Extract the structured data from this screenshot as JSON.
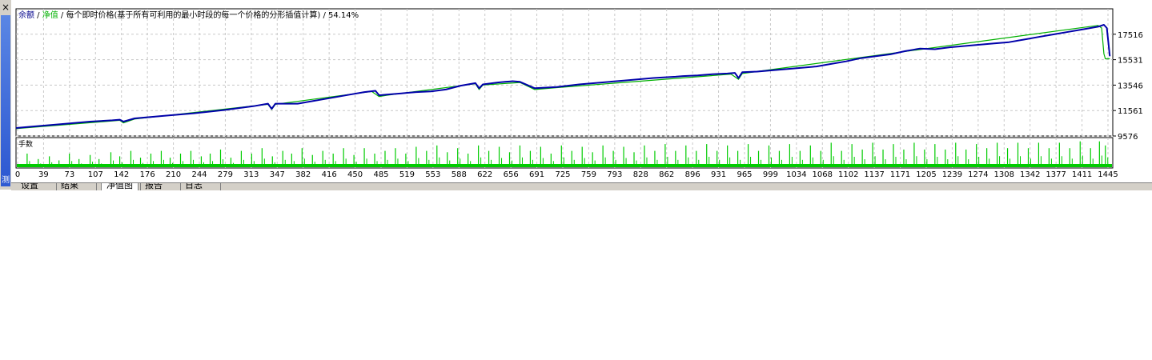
{
  "window": {
    "close_label": "×",
    "side_label": "测"
  },
  "chart_data": {
    "type": "line",
    "title_parts": [
      {
        "text": "余额",
        "color": "#00008b"
      },
      {
        "text": " / ",
        "color": "#000000"
      },
      {
        "text": "净值",
        "color": "#00b000"
      },
      {
        "text": " / 每个即时价格(基于所有可利用的最小时段的每一个价格的分形插值计算) / 54.14%",
        "color": "#000000"
      }
    ],
    "ylim": [
      9576,
      19500
    ],
    "y_ticks": [
      "17516",
      "15531",
      "13546",
      "11561",
      "9576"
    ],
    "x_ticks": [
      "0",
      "39",
      "73",
      "107",
      "142",
      "176",
      "210",
      "244",
      "279",
      "313",
      "347",
      "382",
      "416",
      "450",
      "485",
      "519",
      "553",
      "588",
      "622",
      "656",
      "691",
      "725",
      "759",
      "793",
      "828",
      "862",
      "896",
      "931",
      "965",
      "999",
      "1034",
      "1068",
      "1102",
      "1137",
      "1171",
      "1205",
      "1239",
      "1274",
      "1308",
      "1342",
      "1377",
      "1411",
      "1445"
    ],
    "xlim": [
      0,
      1480
    ],
    "series": [
      {
        "name": "余额",
        "color": "#0000aa",
        "x": [
          0,
          20,
          60,
          100,
          130,
          140,
          145,
          160,
          200,
          240,
          280,
          320,
          340,
          345,
          350,
          380,
          400,
          420,
          450,
          470,
          485,
          490,
          500,
          520,
          540,
          560,
          580,
          600,
          620,
          625,
          630,
          650,
          660,
          670,
          680,
          700,
          730,
          760,
          790,
          820,
          860,
          890,
          900,
          920,
          940,
          960,
          970,
          975,
          980,
          1000,
          1030,
          1060,
          1080,
          1100,
          1120,
          1140,
          1160,
          1180,
          1200,
          1210,
          1220,
          1240,
          1260,
          1280,
          1300,
          1320,
          1340,
          1360,
          1380,
          1400,
          1420,
          1440,
          1460,
          1468,
          1472,
          1476
        ],
        "values": [
          10200,
          10300,
          10500,
          10700,
          10800,
          10850,
          10700,
          10950,
          11150,
          11350,
          11600,
          11900,
          12100,
          11700,
          12100,
          12100,
          12300,
          12500,
          12800,
          13000,
          13100,
          12750,
          12800,
          12900,
          13000,
          13050,
          13200,
          13500,
          13700,
          13300,
          13600,
          13750,
          13800,
          13850,
          13800,
          13300,
          13400,
          13600,
          13750,
          13900,
          14100,
          14200,
          14250,
          14300,
          14400,
          14450,
          14500,
          14100,
          14550,
          14600,
          14750,
          14900,
          15000,
          15200,
          15400,
          15650,
          15800,
          15950,
          16200,
          16300,
          16400,
          16350,
          16500,
          16600,
          16700,
          16800,
          16900,
          17100,
          17300,
          17500,
          17700,
          17900,
          18100,
          18250,
          18000,
          15800
        ]
      },
      {
        "name": "净值",
        "color": "#00b000",
        "x": [
          0,
          140,
          145,
          160,
          340,
          345,
          350,
          480,
          490,
          500,
          620,
          625,
          630,
          680,
          700,
          730,
          965,
          975,
          980,
          1460,
          1465,
          1468,
          1470,
          1476
        ],
        "values": [
          10150,
          10800,
          10600,
          10900,
          12050,
          11650,
          12050,
          13050,
          12650,
          12750,
          13650,
          13200,
          13550,
          13750,
          13200,
          13350,
          14400,
          14000,
          14450,
          18200,
          18000,
          16000,
          15600,
          15600
        ]
      }
    ],
    "sub_chart": {
      "label": "手数",
      "color": "#00cc00",
      "spikes": [
        {
          "x": 15,
          "h": 0.5
        },
        {
          "x": 30,
          "h": 0.3
        },
        {
          "x": 45,
          "h": 0.4
        },
        {
          "x": 58,
          "h": 0.25
        },
        {
          "x": 72,
          "h": 0.5
        },
        {
          "x": 85,
          "h": 0.3
        },
        {
          "x": 100,
          "h": 0.45
        },
        {
          "x": 112,
          "h": 0.3
        },
        {
          "x": 128,
          "h": 0.55
        },
        {
          "x": 140,
          "h": 0.4
        },
        {
          "x": 155,
          "h": 0.6
        },
        {
          "x": 168,
          "h": 0.35
        },
        {
          "x": 182,
          "h": 0.5
        },
        {
          "x": 196,
          "h": 0.6
        },
        {
          "x": 208,
          "h": 0.35
        },
        {
          "x": 222,
          "h": 0.5
        },
        {
          "x": 236,
          "h": 0.6
        },
        {
          "x": 250,
          "h": 0.4
        },
        {
          "x": 262,
          "h": 0.5
        },
        {
          "x": 276,
          "h": 0.65
        },
        {
          "x": 290,
          "h": 0.35
        },
        {
          "x": 304,
          "h": 0.6
        },
        {
          "x": 318,
          "h": 0.5
        },
        {
          "x": 332,
          "h": 0.7
        },
        {
          "x": 346,
          "h": 0.4
        },
        {
          "x": 360,
          "h": 0.6
        },
        {
          "x": 372,
          "h": 0.5
        },
        {
          "x": 386,
          "h": 0.7
        },
        {
          "x": 400,
          "h": 0.45
        },
        {
          "x": 414,
          "h": 0.6
        },
        {
          "x": 428,
          "h": 0.5
        },
        {
          "x": 442,
          "h": 0.7
        },
        {
          "x": 456,
          "h": 0.45
        },
        {
          "x": 470,
          "h": 0.7
        },
        {
          "x": 484,
          "h": 0.5
        },
        {
          "x": 498,
          "h": 0.6
        },
        {
          "x": 512,
          "h": 0.7
        },
        {
          "x": 526,
          "h": 0.5
        },
        {
          "x": 540,
          "h": 0.75
        },
        {
          "x": 554,
          "h": 0.6
        },
        {
          "x": 568,
          "h": 0.8
        },
        {
          "x": 582,
          "h": 0.55
        },
        {
          "x": 596,
          "h": 0.7
        },
        {
          "x": 610,
          "h": 0.5
        },
        {
          "x": 624,
          "h": 0.8
        },
        {
          "x": 638,
          "h": 0.6
        },
        {
          "x": 652,
          "h": 0.75
        },
        {
          "x": 666,
          "h": 0.55
        },
        {
          "x": 680,
          "h": 0.8
        },
        {
          "x": 694,
          "h": 0.6
        },
        {
          "x": 708,
          "h": 0.75
        },
        {
          "x": 722,
          "h": 0.5
        },
        {
          "x": 736,
          "h": 0.8
        },
        {
          "x": 750,
          "h": 0.6
        },
        {
          "x": 764,
          "h": 0.75
        },
        {
          "x": 778,
          "h": 0.55
        },
        {
          "x": 792,
          "h": 0.8
        },
        {
          "x": 806,
          "h": 0.6
        },
        {
          "x": 820,
          "h": 0.75
        },
        {
          "x": 834,
          "h": 0.55
        },
        {
          "x": 848,
          "h": 0.8
        },
        {
          "x": 862,
          "h": 0.6
        },
        {
          "x": 876,
          "h": 0.85
        },
        {
          "x": 890,
          "h": 0.6
        },
        {
          "x": 904,
          "h": 0.8
        },
        {
          "x": 918,
          "h": 0.6
        },
        {
          "x": 932,
          "h": 0.85
        },
        {
          "x": 946,
          "h": 0.6
        },
        {
          "x": 960,
          "h": 0.8
        },
        {
          "x": 974,
          "h": 0.6
        },
        {
          "x": 988,
          "h": 0.85
        },
        {
          "x": 1002,
          "h": 0.6
        },
        {
          "x": 1016,
          "h": 0.8
        },
        {
          "x": 1030,
          "h": 0.6
        },
        {
          "x": 1044,
          "h": 0.85
        },
        {
          "x": 1058,
          "h": 0.6
        },
        {
          "x": 1072,
          "h": 0.8
        },
        {
          "x": 1086,
          "h": 0.6
        },
        {
          "x": 1100,
          "h": 0.9
        },
        {
          "x": 1114,
          "h": 0.6
        },
        {
          "x": 1128,
          "h": 0.85
        },
        {
          "x": 1142,
          "h": 0.65
        },
        {
          "x": 1156,
          "h": 0.9
        },
        {
          "x": 1170,
          "h": 0.65
        },
        {
          "x": 1184,
          "h": 0.85
        },
        {
          "x": 1198,
          "h": 0.65
        },
        {
          "x": 1212,
          "h": 0.9
        },
        {
          "x": 1226,
          "h": 0.65
        },
        {
          "x": 1240,
          "h": 0.85
        },
        {
          "x": 1254,
          "h": 0.65
        },
        {
          "x": 1268,
          "h": 0.9
        },
        {
          "x": 1282,
          "h": 0.65
        },
        {
          "x": 1296,
          "h": 0.85
        },
        {
          "x": 1310,
          "h": 0.7
        },
        {
          "x": 1324,
          "h": 0.9
        },
        {
          "x": 1338,
          "h": 0.7
        },
        {
          "x": 1352,
          "h": 0.9
        },
        {
          "x": 1366,
          "h": 0.7
        },
        {
          "x": 1380,
          "h": 0.9
        },
        {
          "x": 1394,
          "h": 0.7
        },
        {
          "x": 1408,
          "h": 0.9
        },
        {
          "x": 1422,
          "h": 0.7
        },
        {
          "x": 1436,
          "h": 0.95
        },
        {
          "x": 1450,
          "h": 0.7
        },
        {
          "x": 1462,
          "h": 0.95
        },
        {
          "x": 1470,
          "h": 0.8
        }
      ]
    }
  },
  "tabs": [
    {
      "label": "设置",
      "active": false
    },
    {
      "label": "结果",
      "active": false
    },
    {
      "label": "净值图",
      "active": true
    },
    {
      "label": "报告",
      "active": false
    },
    {
      "label": "日志",
      "active": false
    }
  ]
}
